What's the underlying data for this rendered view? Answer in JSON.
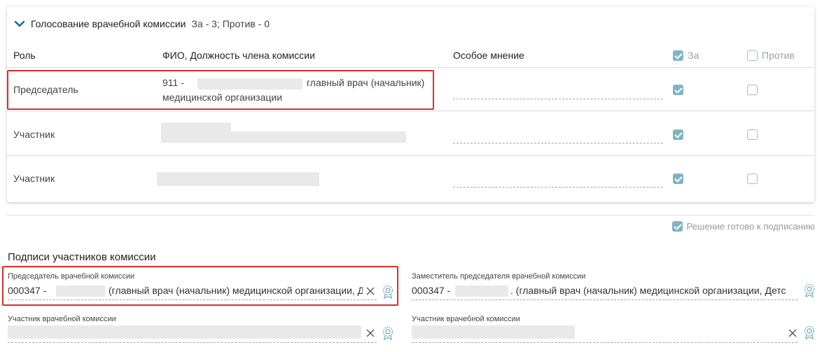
{
  "voting": {
    "title": "Голосование врачебной комиссии",
    "summary": "За - 3; Против - 0",
    "columns": {
      "role": "Роль",
      "member": "ФИО, Должность члена комиссии",
      "opinion": "Особое мнение",
      "for": "За",
      "against": "Против"
    },
    "rows": [
      {
        "role": "Председатель",
        "member_prefix": "911 -",
        "member_suffix": "главный врач (начальник)",
        "member_line2": "медицинской организации",
        "for": true,
        "against": false
      },
      {
        "role": "Участник",
        "for": true,
        "against": false
      },
      {
        "role": "Участник",
        "for": true,
        "against": false
      }
    ]
  },
  "ready_label": "Решение готово к подписанию",
  "signatures": {
    "title": "Подписи участников комиссии",
    "chairman": {
      "label": "Председатель врачебной комиссии",
      "prefix": "000347 -",
      "suffix": "(главный врач (начальник) медицинской организации, Дет"
    },
    "deputy": {
      "label": "Заместитель председателя врачебной комиссии",
      "prefix": "000347 -",
      "suffix": ". (главный врач (начальник) медицинской организации, Детская"
    },
    "member1": {
      "label": "Участник врачебной комиссии"
    },
    "member2": {
      "label": "Участник врачебной комиссии"
    }
  },
  "colors": {
    "accent": "#0f6b8c",
    "checkbox": "#7fb5c3",
    "highlight": "#d9302c"
  }
}
